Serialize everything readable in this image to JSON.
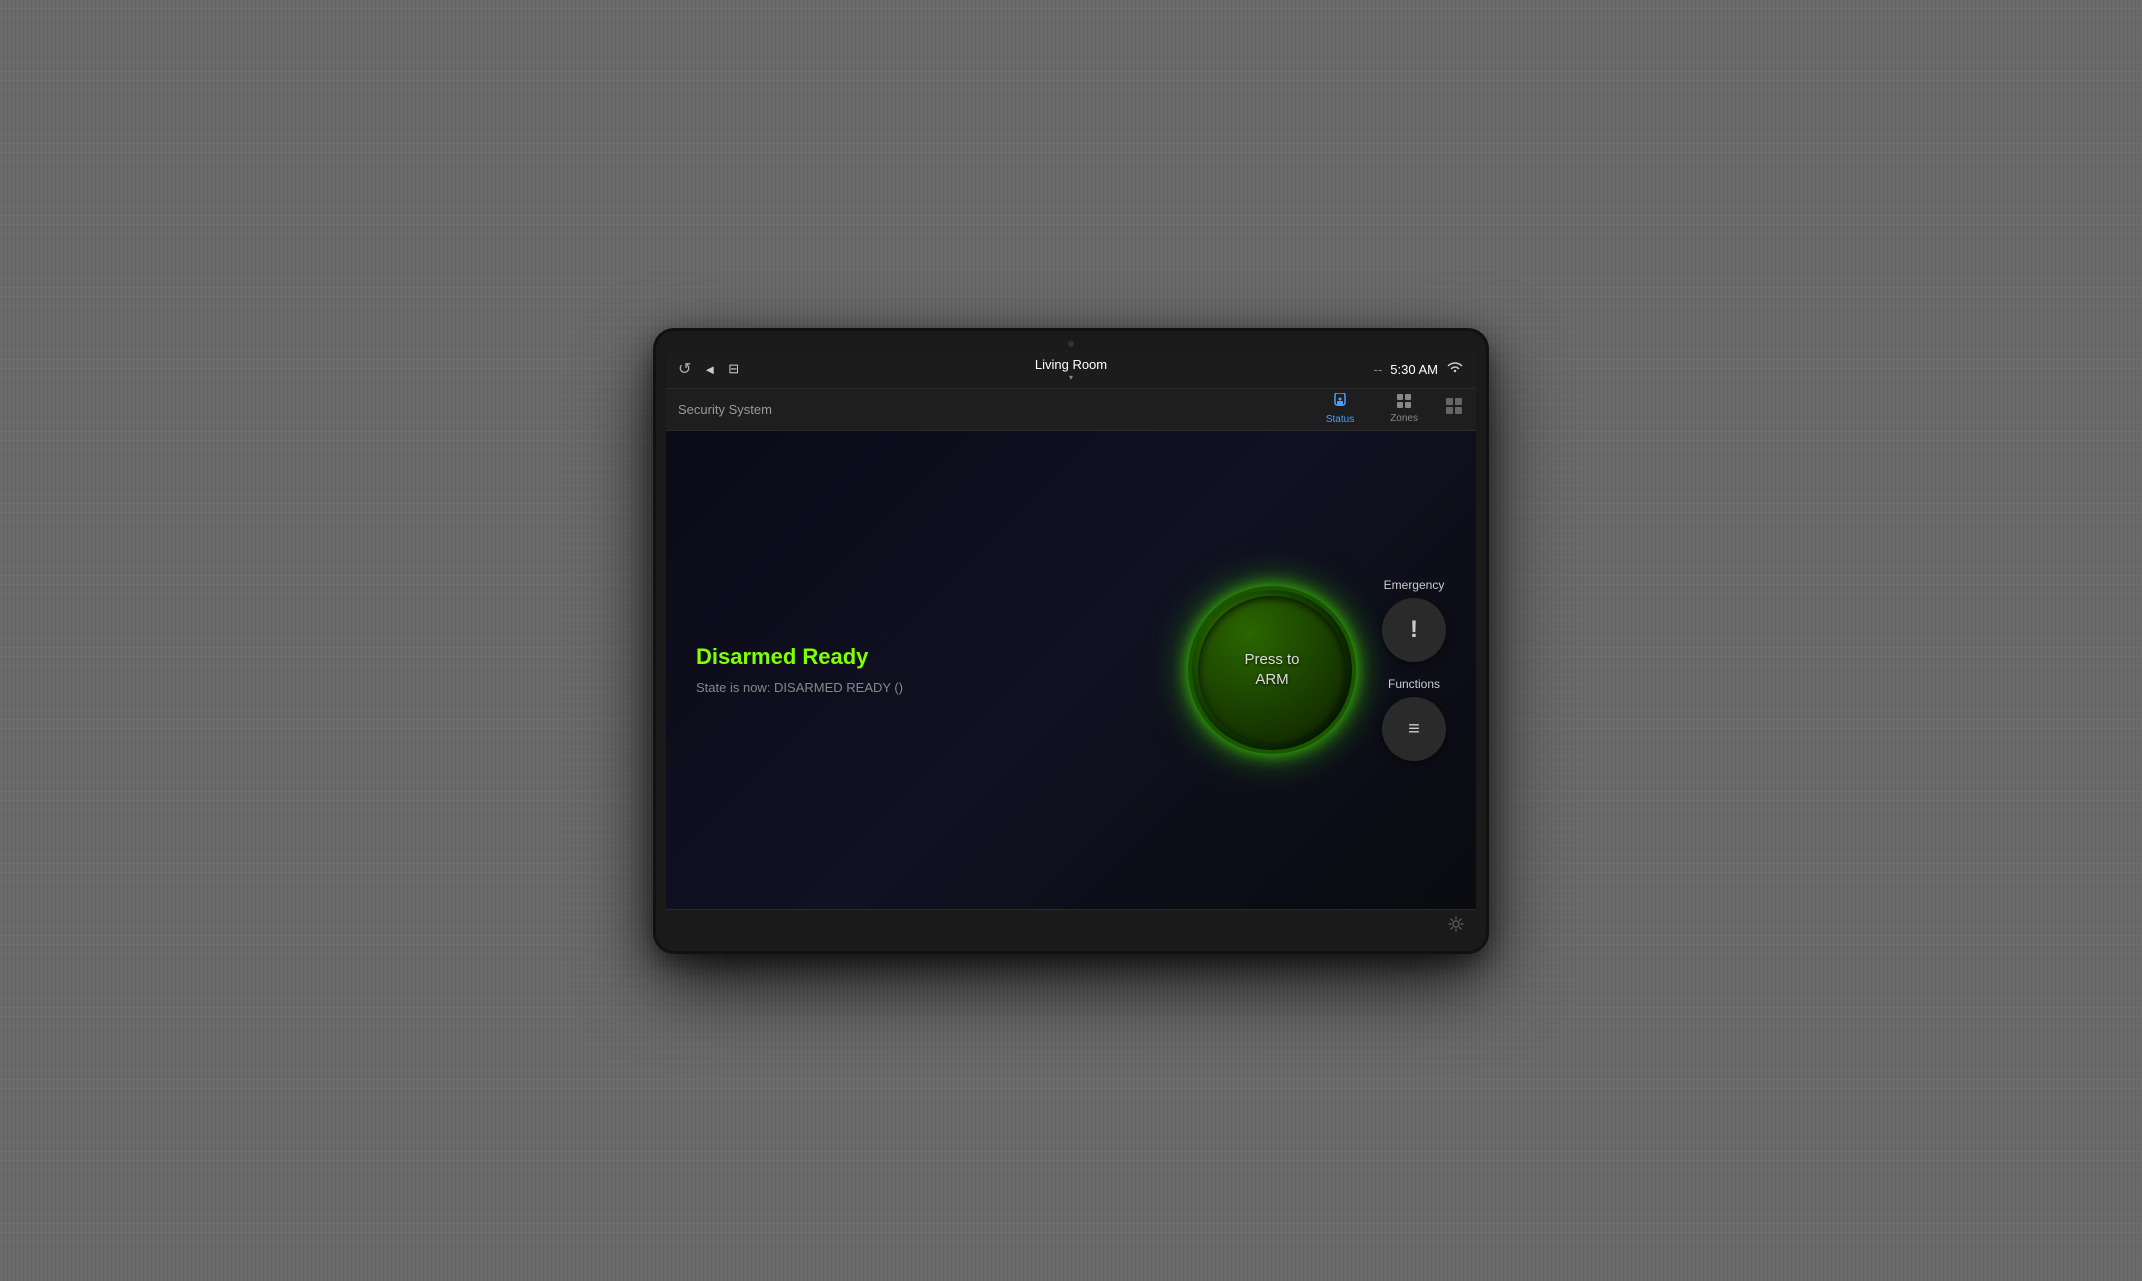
{
  "device": {
    "camera_label": "camera"
  },
  "status_bar": {
    "back_icon": "◄",
    "home_icon": "⌂",
    "grid_icon": "⚏",
    "location": "Living Room",
    "location_chevron": "▾",
    "separator": "--",
    "time": "5:30 AM",
    "wifi_icon": "wifi"
  },
  "nav_bar": {
    "title": "Security System",
    "tabs": [
      {
        "id": "status",
        "label": "Status",
        "icon": "🔒",
        "active": true
      },
      {
        "id": "zones",
        "label": "Zones",
        "icon": "⊞",
        "active": false
      }
    ],
    "grid_btn": "⊞"
  },
  "main": {
    "status_label": "Disarmed Ready",
    "state_text": "State is now: DISARMED READY ()",
    "arm_button_line1": "Press to",
    "arm_button_line2": "ARM",
    "emergency_label": "Emergency",
    "emergency_icon": "!",
    "functions_label": "Functions",
    "functions_icon": "≡"
  },
  "bottom_bar": {
    "settings_icon": "⚙"
  },
  "colors": {
    "status_green": "#7fff00",
    "arm_glow": "#4aff00",
    "active_tab": "#4a9eff",
    "bg_dark": "#0d0d1a"
  }
}
